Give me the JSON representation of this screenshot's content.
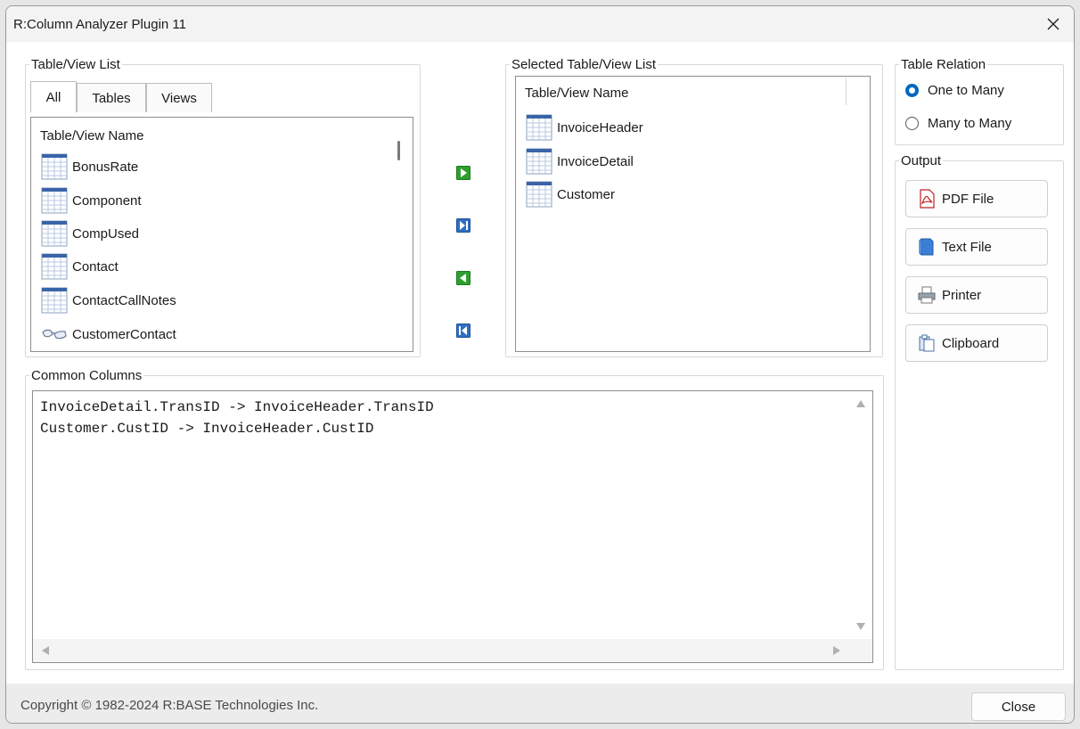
{
  "window": {
    "title": "R:Column Analyzer Plugin 11"
  },
  "table_view_list": {
    "group_label": "Table/View List",
    "tabs": [
      {
        "label": "All",
        "active": true
      },
      {
        "label": "Tables",
        "active": false
      },
      {
        "label": "Views",
        "active": false
      }
    ],
    "column_header": "Table/View Name",
    "items": [
      {
        "name": "BonusRate",
        "icon": "table-icon"
      },
      {
        "name": "Component",
        "icon": "table-icon"
      },
      {
        "name": "CompUsed",
        "icon": "table-icon"
      },
      {
        "name": "Contact",
        "icon": "table-icon"
      },
      {
        "name": "ContactCallNotes",
        "icon": "table-icon"
      },
      {
        "name": "CustomerContact",
        "icon": "view-glasses-icon"
      }
    ]
  },
  "transfer_buttons": [
    {
      "name": "move-right-icon"
    },
    {
      "name": "move-all-right-icon"
    },
    {
      "name": "move-left-icon"
    },
    {
      "name": "move-all-left-icon"
    }
  ],
  "selected_list": {
    "group_label": "Selected Table/View List",
    "column_header": "Table/View Name",
    "items": [
      {
        "name": "InvoiceHeader",
        "icon": "table-icon"
      },
      {
        "name": "InvoiceDetail",
        "icon": "table-icon"
      },
      {
        "name": "Customer",
        "icon": "table-icon"
      }
    ]
  },
  "table_relation": {
    "group_label": "Table Relation",
    "options": [
      {
        "label": "One to Many",
        "selected": true
      },
      {
        "label": "Many to Many",
        "selected": false
      }
    ]
  },
  "output": {
    "group_label": "Output",
    "buttons": [
      {
        "label": "PDF File",
        "icon": "pdf-icon"
      },
      {
        "label": "Text File",
        "icon": "text-file-icon"
      },
      {
        "label": "Printer",
        "icon": "printer-icon"
      },
      {
        "label": "Clipboard",
        "icon": "clipboard-icon"
      }
    ]
  },
  "common_columns": {
    "group_label": "Common Columns",
    "lines": [
      "InvoiceDetail.TransID -> InvoiceHeader.TransID",
      "Customer.CustID -> InvoiceHeader.CustID"
    ]
  },
  "footer": {
    "copyright": "Copyright © 1982-2024 R:BASE Technologies Inc.",
    "close_label": "Close"
  },
  "colors": {
    "accent": "#0067c0",
    "window_bg": "#ffffff",
    "footer_bg": "#ececec"
  }
}
